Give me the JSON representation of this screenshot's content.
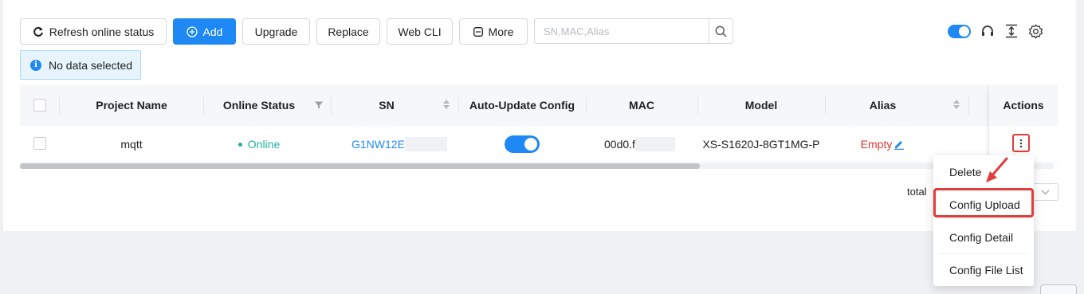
{
  "toolbar": {
    "refresh_label": "Refresh online status",
    "add_label": "Add",
    "upgrade_label": "Upgrade",
    "replace_label": "Replace",
    "webcli_label": "Web CLI",
    "more_label": "More",
    "search_placeholder": "SN,MAC,Alias"
  },
  "alert": {
    "text": "No data selected"
  },
  "table": {
    "columns": [
      "Project Name",
      "Online Status",
      "SN",
      "Auto-Update Config",
      "MAC",
      "Model",
      "Alias",
      "Actions"
    ],
    "rows": [
      {
        "project_name": "mqtt",
        "online_status": "Online",
        "sn": "G1NW12E",
        "auto_update": true,
        "mac": "00d0.f",
        "model": "XS-S1620J-8GT1MG-P",
        "alias": "Empty"
      }
    ]
  },
  "pagination": {
    "total_label": "total"
  },
  "actions_menu": {
    "items": [
      "Delete",
      "Config Upload",
      "Config Detail",
      "Config File List"
    ],
    "highlighted": "Config Upload"
  },
  "colors": {
    "primary": "#1e88f5",
    "online": "#20b2a0",
    "alias_empty": "#e0392b",
    "highlight": "#e23c3c"
  },
  "icons": [
    "refresh-icon",
    "plus-circle-icon",
    "more-square-icon",
    "search-icon",
    "toggle-switch",
    "headset-icon",
    "align-icon",
    "gear-icon",
    "info-icon",
    "filter-icon",
    "sort-icon",
    "edit-pencil-icon",
    "kebab-icon",
    "chevron-down-icon",
    "arrow-icon"
  ]
}
